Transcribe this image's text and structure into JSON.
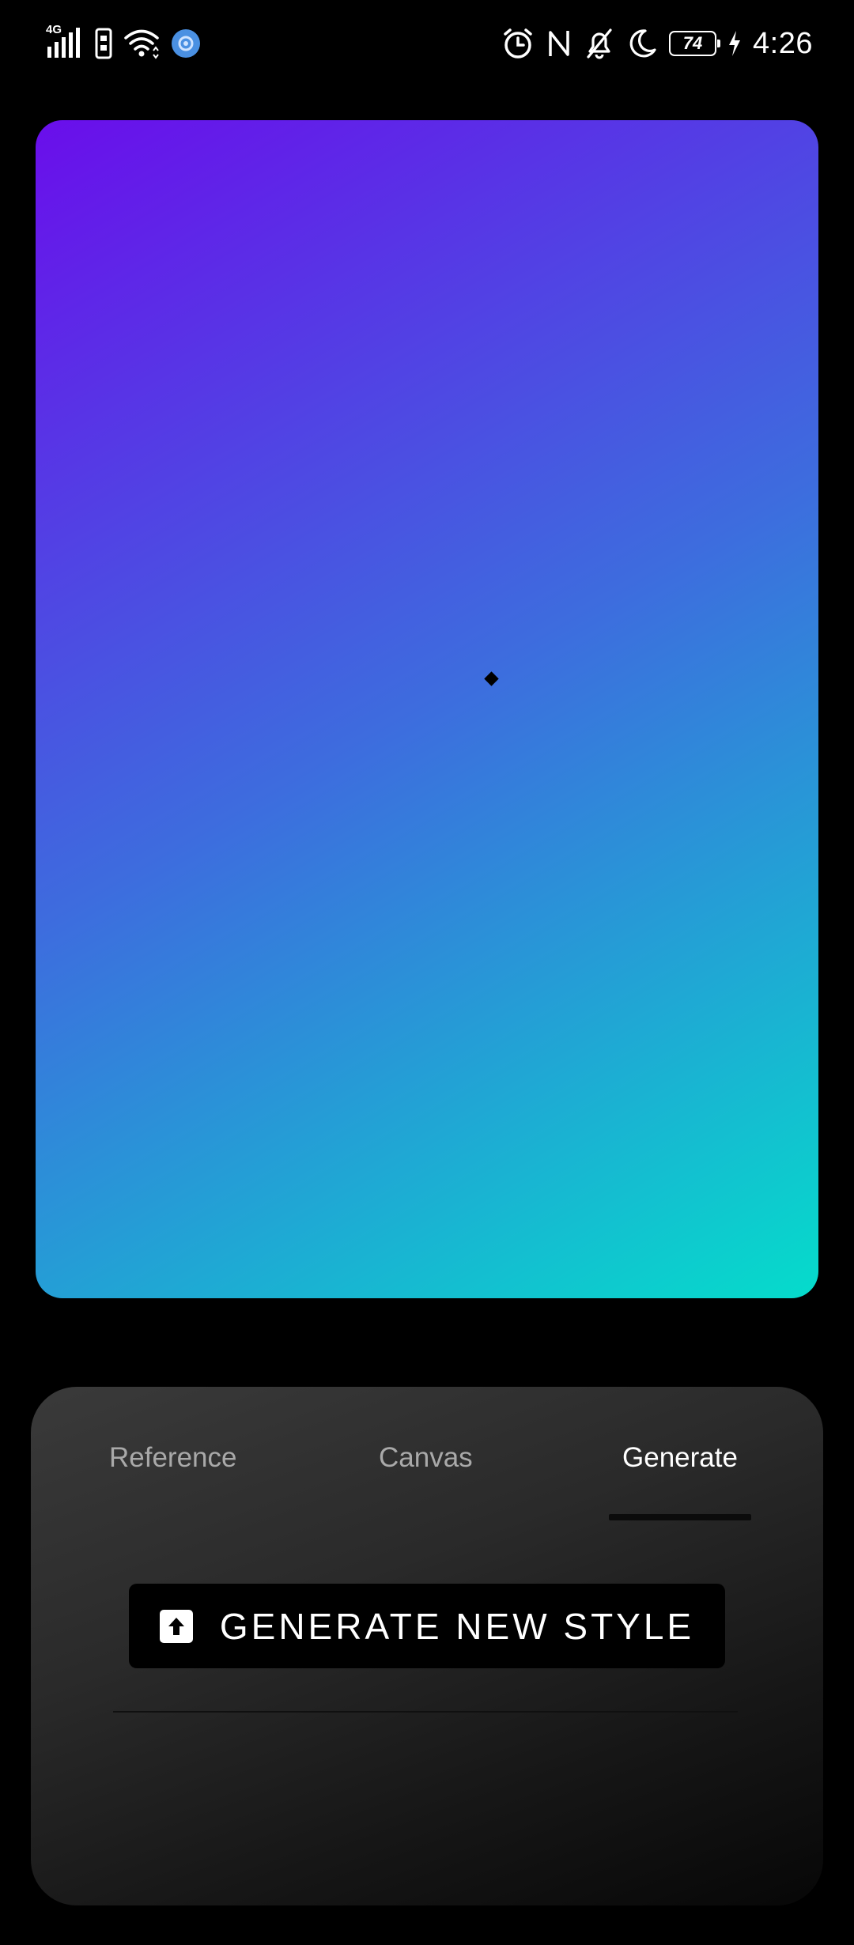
{
  "status_bar": {
    "network_type": "4G",
    "battery_level": "74",
    "time": "4:26",
    "icons": [
      "signal-icon",
      "sim-icon",
      "wifi-icon",
      "vpn-icon",
      "alarm-icon",
      "nfc-icon",
      "mute-icon",
      "do-not-disturb-icon",
      "battery-icon",
      "charging-icon"
    ]
  },
  "preview": {
    "gradient_start": "#6A0EEB",
    "gradient_mid": "#3D6DDE",
    "gradient_end": "#05DCCB"
  },
  "panel": {
    "tabs": [
      {
        "label": "Reference"
      },
      {
        "label": "Canvas"
      },
      {
        "label": "Generate"
      }
    ],
    "active_tab": "Generate",
    "generate_button": {
      "label": "GENERATE NEW STYLE",
      "icon": "upload-icon"
    }
  }
}
